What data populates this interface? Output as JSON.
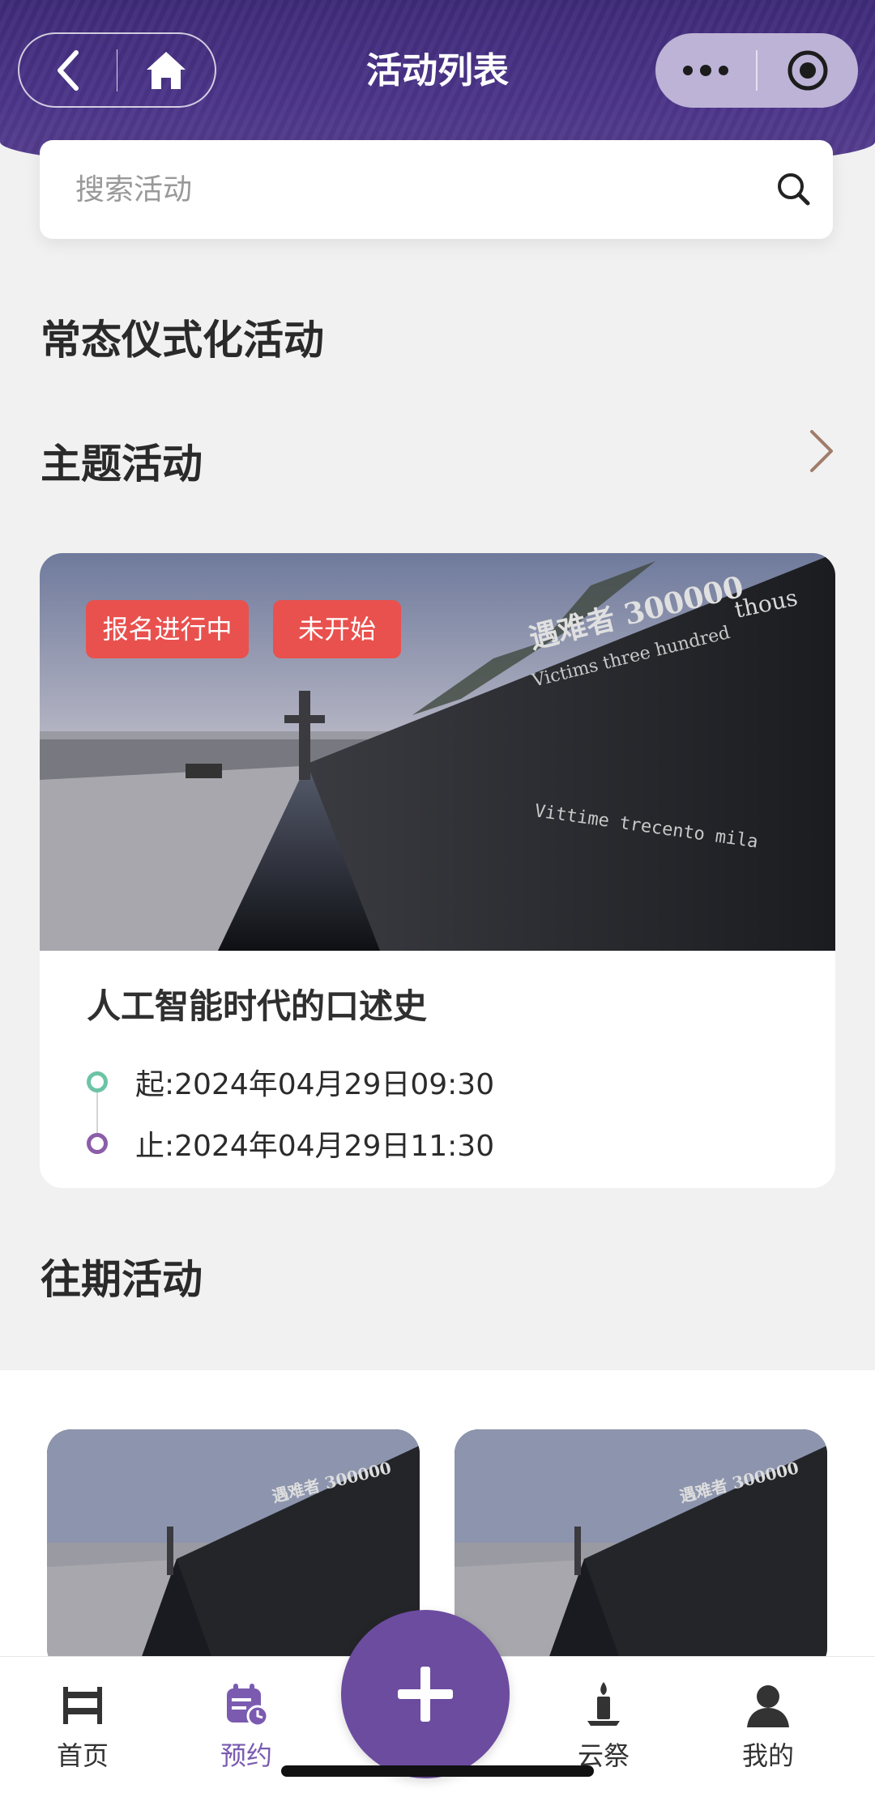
{
  "header": {
    "title": "活动列表"
  },
  "search": {
    "placeholder": "搜索活动"
  },
  "sections": {
    "regular": "常态仪式化活动",
    "theme": "主题活动",
    "past": "往期活动"
  },
  "feature": {
    "tags": [
      "报名进行中",
      "未开始"
    ],
    "title": "人工智能时代的口述史",
    "start": "起:2024年04月29日09:30",
    "end": "止:2024年04月29日11:30",
    "image_text": {
      "victims": "遇难者 300000",
      "english": "Victims three hundred",
      "thous": "thous",
      "italian": "Vittime trecento mila"
    }
  },
  "tabbar": {
    "items": [
      {
        "label": "首页",
        "icon": "home-icon",
        "active": false
      },
      {
        "label": "预约",
        "icon": "calendar-icon",
        "active": true
      },
      {
        "label": "云祭",
        "icon": "candle-icon",
        "active": false
      },
      {
        "label": "我的",
        "icon": "user-icon",
        "active": false
      }
    ],
    "fab_icon": "plus-icon"
  },
  "colors": {
    "brand": "#5b3f92",
    "tag": "#e9514e",
    "start_dot": "#6cc4a4",
    "end_dot": "#8c5da8",
    "active_tab": "#7a5bb0"
  }
}
